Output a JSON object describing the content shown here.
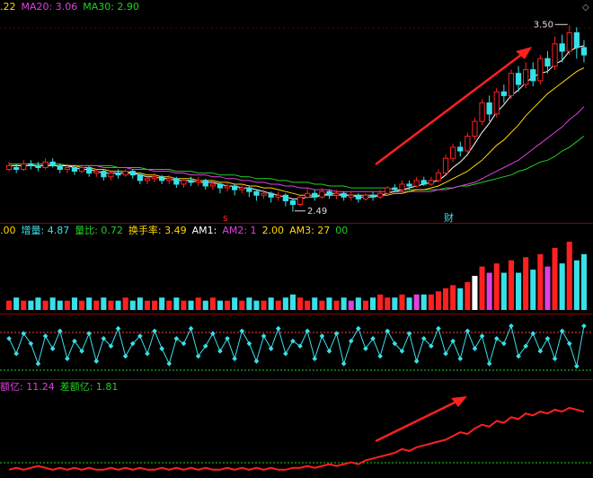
{
  "colors": {
    "up": "#ff2020",
    "down": "#38e0e8",
    "ma5": "#ffffff",
    "ma10": "#ffd700",
    "ma20": "#e040e0",
    "ma30": "#20d020",
    "vol_up": "#ff2020",
    "vol_down": "#38e0e8",
    "vol_special": "#e040e0",
    "dot": "#38e0e8",
    "arrow": "#ff2020",
    "line": "#ff2020"
  },
  "price_panel": {
    "ma_labels": [
      {
        "text": ".22",
        "color": "#ffd700"
      },
      {
        "text": "MA20: 3.06",
        "color": "#e040e0"
      },
      {
        "text": "MA30: 2.90",
        "color": "#20d020"
      }
    ],
    "high_label": "3.50",
    "low_label": "2.49",
    "caijie_label": "财",
    "s_label": "s"
  },
  "volume_panel": {
    "labels": [
      {
        "text": ".00",
        "color": "#ffd700"
      },
      {
        "text": "增量: 4.87",
        "color": "#38e0e8"
      },
      {
        "text": "量比: 0.72",
        "color": "#20d020"
      },
      {
        "text": "换手率: 3.49",
        "color": "#ffd700"
      },
      {
        "text": "AM1:",
        "color": "#ffffff"
      },
      {
        "text": "AM2: 1",
        "color": "#e040e0"
      },
      {
        "text": "2.00",
        "color": "#ffd700"
      },
      {
        "text": "AM3: 27",
        "color": "#ffd700"
      },
      {
        "text": "00",
        "color": "#20d020"
      }
    ]
  },
  "money_panel": {
    "labels": [
      {
        "text": "额亿: 11.24",
        "color": "#e040e0"
      },
      {
        "text": "差额亿: 1.81",
        "color": "#20d020"
      }
    ]
  },
  "chart_data": {
    "type": "candlestick",
    "candles": [
      [
        2.72,
        2.74,
        2.76,
        2.71
      ],
      [
        2.73,
        2.72,
        2.75,
        2.7
      ],
      [
        2.72,
        2.75,
        2.77,
        2.71
      ],
      [
        2.75,
        2.74,
        2.77,
        2.72
      ],
      [
        2.74,
        2.73,
        2.76,
        2.71
      ],
      [
        2.73,
        2.76,
        2.78,
        2.72
      ],
      [
        2.76,
        2.74,
        2.78,
        2.73
      ],
      [
        2.74,
        2.72,
        2.75,
        2.7
      ],
      [
        2.72,
        2.73,
        2.75,
        2.7
      ],
      [
        2.73,
        2.71,
        2.74,
        2.69
      ],
      [
        2.71,
        2.73,
        2.74,
        2.7
      ],
      [
        2.73,
        2.7,
        2.74,
        2.68
      ],
      [
        2.7,
        2.71,
        2.72,
        2.68
      ],
      [
        2.71,
        2.68,
        2.72,
        2.66
      ],
      [
        2.68,
        2.7,
        2.71,
        2.66
      ],
      [
        2.7,
        2.69,
        2.72,
        2.67
      ],
      [
        2.69,
        2.71,
        2.72,
        2.68
      ],
      [
        2.71,
        2.69,
        2.72,
        2.67
      ],
      [
        2.69,
        2.66,
        2.7,
        2.64
      ],
      [
        2.66,
        2.67,
        2.69,
        2.64
      ],
      [
        2.67,
        2.68,
        2.7,
        2.65
      ],
      [
        2.68,
        2.66,
        2.69,
        2.64
      ],
      [
        2.66,
        2.67,
        2.69,
        2.64
      ],
      [
        2.67,
        2.64,
        2.68,
        2.62
      ],
      [
        2.64,
        2.66,
        2.67,
        2.62
      ],
      [
        2.66,
        2.65,
        2.68,
        2.63
      ],
      [
        2.65,
        2.66,
        2.68,
        2.63
      ],
      [
        2.66,
        2.63,
        2.67,
        2.61
      ],
      [
        2.63,
        2.64,
        2.66,
        2.61
      ],
      [
        2.64,
        2.62,
        2.65,
        2.59
      ],
      [
        2.62,
        2.63,
        2.65,
        2.6
      ],
      [
        2.63,
        2.61,
        2.64,
        2.58
      ],
      [
        2.61,
        2.62,
        2.64,
        2.59
      ],
      [
        2.62,
        2.6,
        2.63,
        2.57
      ],
      [
        2.6,
        2.58,
        2.61,
        2.55
      ],
      [
        2.58,
        2.59,
        2.61,
        2.56
      ],
      [
        2.59,
        2.57,
        2.6,
        2.54
      ],
      [
        2.57,
        2.58,
        2.6,
        2.55
      ],
      [
        2.58,
        2.55,
        2.59,
        2.52
      ],
      [
        2.55,
        2.53,
        2.56,
        2.49
      ],
      [
        2.53,
        2.57,
        2.58,
        2.52
      ],
      [
        2.57,
        2.59,
        2.62,
        2.56
      ],
      [
        2.59,
        2.57,
        2.61,
        2.55
      ],
      [
        2.57,
        2.6,
        2.62,
        2.56
      ],
      [
        2.6,
        2.58,
        2.61,
        2.56
      ],
      [
        2.58,
        2.59,
        2.61,
        2.56
      ],
      [
        2.59,
        2.57,
        2.6,
        2.55
      ],
      [
        2.57,
        2.58,
        2.6,
        2.55
      ],
      [
        2.58,
        2.56,
        2.59,
        2.54
      ],
      [
        2.56,
        2.58,
        2.59,
        2.55
      ],
      [
        2.58,
        2.57,
        2.6,
        2.55
      ],
      [
        2.57,
        2.59,
        2.61,
        2.56
      ],
      [
        2.59,
        2.62,
        2.63,
        2.58
      ],
      [
        2.62,
        2.61,
        2.64,
        2.6
      ],
      [
        2.61,
        2.64,
        2.66,
        2.6
      ],
      [
        2.64,
        2.63,
        2.66,
        2.61
      ],
      [
        2.63,
        2.66,
        2.68,
        2.62
      ],
      [
        2.66,
        2.64,
        2.68,
        2.63
      ],
      [
        2.64,
        2.66,
        2.68,
        2.63
      ],
      [
        2.66,
        2.7,
        2.72,
        2.65
      ],
      [
        2.7,
        2.78,
        2.8,
        2.69
      ],
      [
        2.78,
        2.84,
        2.86,
        2.76
      ],
      [
        2.84,
        2.82,
        2.87,
        2.79
      ],
      [
        2.82,
        2.9,
        2.92,
        2.81
      ],
      [
        2.9,
        2.98,
        3.0,
        2.88
      ],
      [
        2.98,
        3.08,
        3.1,
        2.96
      ],
      [
        3.08,
        3.02,
        3.12,
        2.98
      ],
      [
        3.02,
        3.14,
        3.16,
        3.0
      ],
      [
        3.14,
        3.12,
        3.18,
        3.08
      ],
      [
        3.12,
        3.24,
        3.26,
        3.1
      ],
      [
        3.24,
        3.18,
        3.28,
        3.14
      ],
      [
        3.18,
        3.26,
        3.3,
        3.16
      ],
      [
        3.26,
        3.2,
        3.3,
        3.17
      ],
      [
        3.2,
        3.32,
        3.34,
        3.18
      ],
      [
        3.32,
        3.28,
        3.36,
        3.24
      ],
      [
        3.28,
        3.4,
        3.44,
        3.26
      ],
      [
        3.4,
        3.36,
        3.45,
        3.3
      ],
      [
        3.36,
        3.46,
        3.5,
        3.34
      ],
      [
        3.46,
        3.38,
        3.49,
        3.32
      ],
      [
        3.38,
        3.34,
        3.42,
        3.3
      ]
    ],
    "ylim": [
      2.45,
      3.55
    ],
    "volume": [
      3,
      4,
      3,
      3,
      4,
      3,
      4,
      3,
      3,
      4,
      3,
      4,
      3,
      4,
      3,
      3,
      4,
      3,
      4,
      3,
      3,
      4,
      3,
      4,
      3,
      3,
      4,
      3,
      4,
      3,
      3,
      4,
      3,
      4,
      3,
      3,
      4,
      3,
      4,
      5,
      4,
      3,
      4,
      3,
      4,
      3,
      4,
      3,
      4,
      3,
      4,
      5,
      4,
      4,
      5,
      4,
      5,
      5,
      5,
      6,
      7,
      8,
      7,
      9,
      11,
      14,
      12,
      15,
      12,
      16,
      12,
      17,
      13,
      18,
      14,
      20,
      15,
      22,
      16,
      18
    ],
    "money": [
      2,
      3,
      2,
      3,
      4,
      3,
      2,
      3,
      2,
      3,
      2,
      3,
      2,
      2,
      3,
      2,
      3,
      2,
      3,
      2,
      2,
      3,
      2,
      3,
      2,
      3,
      2,
      3,
      2,
      2,
      3,
      2,
      3,
      2,
      3,
      2,
      3,
      2,
      2,
      3,
      3,
      4,
      3,
      4,
      5,
      4,
      5,
      6,
      5,
      7,
      8,
      9,
      10,
      11,
      13,
      12,
      14,
      15,
      16,
      17,
      18,
      20,
      22,
      21,
      24,
      26,
      25,
      28,
      27,
      30,
      29,
      32,
      31,
      33,
      32,
      34,
      33,
      35,
      34,
      33
    ],
    "oscillator": [
      70,
      40,
      80,
      60,
      20,
      75,
      50,
      85,
      30,
      65,
      45,
      80,
      25,
      70,
      55,
      90,
      35,
      60,
      75,
      40,
      85,
      50,
      20,
      70,
      60,
      90,
      35,
      55,
      80,
      45,
      70,
      30,
      85,
      60,
      25,
      75,
      50,
      90,
      40,
      65,
      55,
      85,
      30,
      75,
      45,
      80,
      20,
      65,
      90,
      50,
      70,
      35,
      85,
      60,
      45,
      80,
      25,
      70,
      55,
      90,
      40,
      65,
      30,
      85,
      50,
      75,
      20,
      70,
      60,
      95,
      35,
      55,
      80,
      45,
      70,
      30,
      85,
      60,
      15,
      95
    ],
    "ma5": [
      2.74,
      2.74,
      2.74,
      2.74,
      2.74,
      2.74,
      2.74,
      2.74,
      2.74,
      2.73,
      2.72,
      2.72,
      2.71,
      2.7,
      2.7,
      2.7,
      2.7,
      2.7,
      2.69,
      2.68,
      2.68,
      2.67,
      2.67,
      2.66,
      2.66,
      2.66,
      2.65,
      2.65,
      2.65,
      2.64,
      2.63,
      2.63,
      2.62,
      2.62,
      2.61,
      2.6,
      2.59,
      2.58,
      2.57,
      2.56,
      2.56,
      2.57,
      2.57,
      2.58,
      2.59,
      2.59,
      2.58,
      2.58,
      2.57,
      2.57,
      2.57,
      2.58,
      2.59,
      2.6,
      2.61,
      2.62,
      2.63,
      2.64,
      2.65,
      2.66,
      2.69,
      2.73,
      2.76,
      2.8,
      2.86,
      2.92,
      2.97,
      3.03,
      3.07,
      3.12,
      3.15,
      3.19,
      3.22,
      3.24,
      3.25,
      3.29,
      3.31,
      3.36,
      3.38,
      3.39
    ],
    "ma10": [
      2.74,
      2.74,
      2.74,
      2.74,
      2.74,
      2.74,
      2.74,
      2.74,
      2.74,
      2.74,
      2.73,
      2.73,
      2.72,
      2.72,
      2.71,
      2.71,
      2.71,
      2.7,
      2.7,
      2.69,
      2.69,
      2.68,
      2.68,
      2.67,
      2.67,
      2.67,
      2.66,
      2.66,
      2.66,
      2.65,
      2.65,
      2.64,
      2.64,
      2.63,
      2.63,
      2.62,
      2.62,
      2.61,
      2.6,
      2.59,
      2.58,
      2.58,
      2.58,
      2.58,
      2.58,
      2.58,
      2.58,
      2.58,
      2.58,
      2.58,
      2.58,
      2.58,
      2.58,
      2.59,
      2.59,
      2.6,
      2.61,
      2.61,
      2.62,
      2.63,
      2.65,
      2.67,
      2.69,
      2.71,
      2.74,
      2.77,
      2.81,
      2.85,
      2.88,
      2.92,
      2.96,
      3.01,
      3.05,
      3.09,
      3.13,
      3.16,
      3.19,
      3.22,
      3.25,
      3.27
    ],
    "ma20": [
      2.74,
      2.74,
      2.74,
      2.74,
      2.74,
      2.74,
      2.74,
      2.74,
      2.74,
      2.74,
      2.74,
      2.74,
      2.74,
      2.73,
      2.73,
      2.73,
      2.73,
      2.72,
      2.72,
      2.72,
      2.71,
      2.71,
      2.71,
      2.7,
      2.7,
      2.69,
      2.69,
      2.69,
      2.68,
      2.68,
      2.67,
      2.67,
      2.66,
      2.66,
      2.65,
      2.65,
      2.64,
      2.64,
      2.63,
      2.63,
      2.62,
      2.62,
      2.61,
      2.61,
      2.61,
      2.6,
      2.6,
      2.6,
      2.6,
      2.6,
      2.6,
      2.6,
      2.6,
      2.6,
      2.6,
      2.6,
      2.6,
      2.6,
      2.6,
      2.61,
      2.61,
      2.62,
      2.63,
      2.64,
      2.65,
      2.67,
      2.69,
      2.71,
      2.73,
      2.75,
      2.77,
      2.8,
      2.83,
      2.86,
      2.89,
      2.92,
      2.95,
      2.99,
      3.02,
      3.06
    ],
    "ma30": [
      2.75,
      2.75,
      2.75,
      2.75,
      2.75,
      2.75,
      2.75,
      2.75,
      2.74,
      2.74,
      2.74,
      2.74,
      2.74,
      2.74,
      2.74,
      2.73,
      2.73,
      2.73,
      2.73,
      2.72,
      2.72,
      2.72,
      2.72,
      2.71,
      2.71,
      2.71,
      2.7,
      2.7,
      2.7,
      2.69,
      2.69,
      2.69,
      2.68,
      2.68,
      2.67,
      2.67,
      2.67,
      2.66,
      2.66,
      2.65,
      2.65,
      2.65,
      2.64,
      2.64,
      2.63,
      2.63,
      2.63,
      2.62,
      2.62,
      2.62,
      2.62,
      2.62,
      2.62,
      2.61,
      2.61,
      2.61,
      2.61,
      2.61,
      2.61,
      2.61,
      2.62,
      2.62,
      2.63,
      2.63,
      2.64,
      2.65,
      2.66,
      2.67,
      2.68,
      2.69,
      2.71,
      2.72,
      2.74,
      2.76,
      2.77,
      2.79,
      2.82,
      2.84,
      2.87,
      2.9
    ]
  }
}
